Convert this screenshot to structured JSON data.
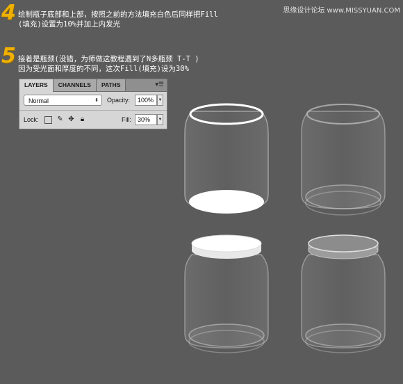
{
  "watermark": "思缘设计论坛 www.MISSYUAN.COM",
  "steps": [
    {
      "number": "4",
      "line1": "绘制瓶子底部和上部，按照之前的方法填充白色后同样把Fill",
      "line2": "(填充)设置为10%并加上内发光"
    },
    {
      "number": "5",
      "line1": "接着是瓶颈(没错，为师做这教程遇到了N多瓶颈 T-T )",
      "line2": "因为受光面和厚度的不同，这次Fill(填充)设为30%"
    }
  ],
  "layers_panel": {
    "tabs": [
      "LAYERS",
      "CHANNELS",
      "PATHS"
    ],
    "active_tab": "LAYERS",
    "menu_icon": "panel-menu-icon",
    "blend_mode": "Normal",
    "opacity_label": "Opacity:",
    "opacity_value": "100%",
    "lock_label": "Lock:",
    "lock_icons": [
      "lock-transparent-icon",
      "lock-image-icon",
      "lock-position-icon",
      "lock-all-icon"
    ],
    "fill_label": "Fill:",
    "fill_value": "30%"
  }
}
